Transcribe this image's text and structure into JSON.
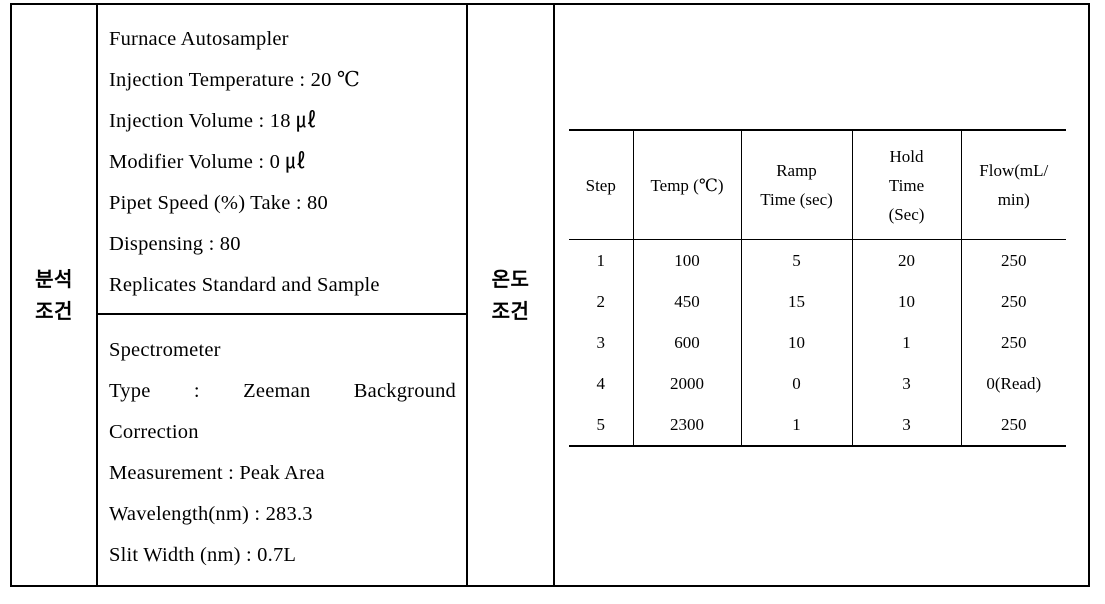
{
  "document": {
    "title": "Analysis and temperature conditions table"
  },
  "analysis_section": {
    "label": "분석\n조건",
    "autosampler_block": {
      "lines": [
        "Furnace Autosampler",
        "Injection Temperature : 20 ℃",
        "Injection Volume : 18 ㎕",
        "Modifier Volume :  0  ㎕",
        "Pipet Speed (%) Take : 80",
        "Dispensing : 80",
        "Replicates Standard and Sample"
      ]
    },
    "spectrometer_block": {
      "lines": [
        "Spectrometer",
        "Type : Zeeman Background",
        "Correction",
        "Measurement : Peak Area",
        "Wavelength(nm) : 283.3",
        "Slit Width (nm) : 0.7L"
      ]
    }
  },
  "temperature_section": {
    "label": "온도\n조건"
  },
  "chart_data": {
    "type": "table",
    "title": "",
    "columns": [
      "Step",
      "Temp (℃)",
      "Ramp\nTime (sec)",
      "Hold\nTime\n(Sec)",
      "Flow(mL/\nmin)"
    ],
    "column_lines": [
      [
        "Step"
      ],
      [
        "Temp (℃)"
      ],
      [
        "Ramp",
        "Time (sec)"
      ],
      [
        "Hold",
        "Time",
        "(Sec)"
      ],
      [
        "Flow(mL/",
        "min)"
      ]
    ],
    "rows": [
      [
        "1",
        "100",
        "5",
        "20",
        "250"
      ],
      [
        "2",
        "450",
        "15",
        "10",
        "250"
      ],
      [
        "3",
        "600",
        "10",
        "1",
        "250"
      ],
      [
        "4",
        "2000",
        "0",
        "3",
        "0(Read)"
      ],
      [
        "5",
        "2300",
        "1",
        "3",
        "250"
      ]
    ]
  },
  "colors": {
    "border": "#000000",
    "background": "#ffffff",
    "text": "#000000"
  }
}
